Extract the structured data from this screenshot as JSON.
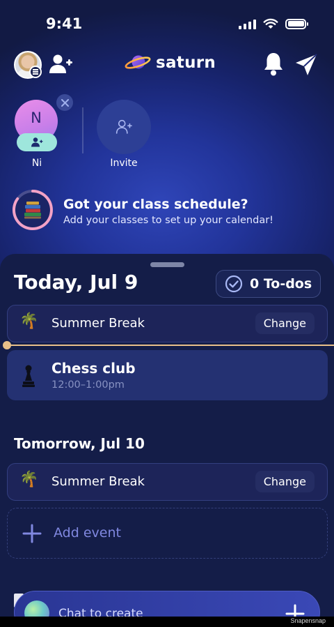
{
  "status_bar": {
    "time": "9:41"
  },
  "header": {
    "logo_text": "saturn"
  },
  "friends": [
    {
      "initial": "N",
      "name": "Ni"
    }
  ],
  "invite": {
    "label": "Invite"
  },
  "schedule_prompt": {
    "title": "Got your class schedule?",
    "subtitle": "Add your classes to set up your calendar!"
  },
  "today": {
    "title": "Today, Jul 9",
    "todo_label": "0 To-dos",
    "all_day_event": {
      "label": "Summer Break",
      "emoji": "🌴",
      "change_label": "Change"
    },
    "events": [
      {
        "title": "Chess club",
        "time": "12:00–1:00pm",
        "icon": "chess-pawn-icon"
      }
    ]
  },
  "tomorrow": {
    "title": "Tomorrow, Jul 10",
    "all_day_event": {
      "label": "Summer Break",
      "emoji": "🌴",
      "change_label": "Change"
    },
    "add_event_label": "Add event"
  },
  "chat_bar": {
    "placeholder": "Chat to create"
  },
  "footer": {
    "watermark": "Snapensnap"
  },
  "colors": {
    "background": "#121a44",
    "sheet": "#141d48",
    "now_line": "#e9c089",
    "accent_purple": "#8088e0"
  }
}
